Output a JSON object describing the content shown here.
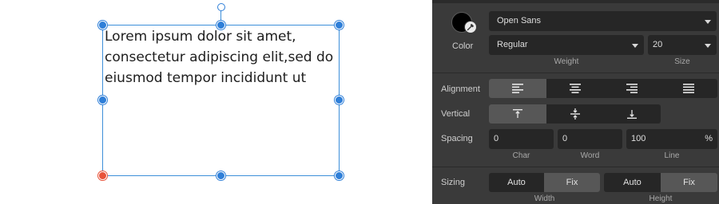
{
  "canvas": {
    "text": "Lorem ipsum dolor sit amet, consectetur adipiscing elit,sed do eiusmod tempor incididunt ut"
  },
  "panel": {
    "font": {
      "family_value": "Open Sans"
    },
    "color": {
      "label": "Color",
      "swatch_color": "#000000"
    },
    "weight": {
      "value": "Regular",
      "caption": "Weight"
    },
    "size": {
      "value": "20",
      "caption": "Size"
    },
    "alignment": {
      "label": "Alignment",
      "options": [
        "left",
        "center",
        "right",
        "justify"
      ],
      "active": "left"
    },
    "vertical": {
      "label": "Vertical",
      "options": [
        "top",
        "middle",
        "bottom"
      ],
      "active": "top"
    },
    "spacing": {
      "label": "Spacing",
      "char": {
        "value": "0",
        "caption": "Char"
      },
      "word": {
        "value": "0",
        "caption": "Word"
      },
      "line": {
        "value": "100",
        "unit": "%",
        "caption": "Line"
      }
    },
    "sizing": {
      "label": "Sizing",
      "width": {
        "auto_label": "Auto",
        "fix_label": "Fix",
        "caption": "Width",
        "active": "Fix"
      },
      "height": {
        "auto_label": "Auto",
        "fix_label": "Fix",
        "caption": "Height",
        "active": "Fix"
      }
    }
  },
  "colors": {
    "selection": "#2f7fd8",
    "anchor_handle": "#e8533a",
    "panel_bg": "#3a3a3a",
    "control_bg": "#262626",
    "active_segment": "#575757"
  }
}
